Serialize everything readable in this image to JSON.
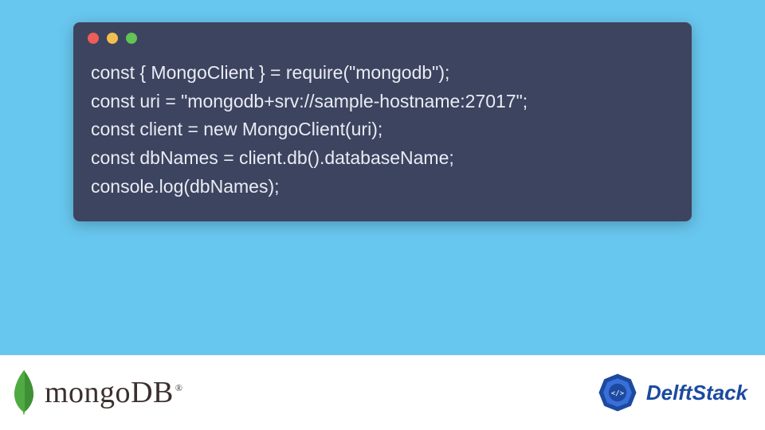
{
  "code": {
    "lines": [
      "const { MongoClient } = require(\"mongodb\");",
      "const uri = \"mongodb+srv://sample-hostname:27017\";",
      "const client = new MongoClient(uri);",
      "const dbNames = client.db().databaseName;",
      "console.log(dbNames);"
    ]
  },
  "window": {
    "dot_red": "close",
    "dot_yellow": "minimize",
    "dot_green": "zoom"
  },
  "footer": {
    "mongo_label": "mongoDB",
    "mongo_trademark": "®",
    "delft_label": "DelftStack"
  },
  "colors": {
    "page_bg": "#68c7ef",
    "card_bg": "#3d445f",
    "code_fg": "#e9ecf4",
    "mongo_leaf": "#4faa41",
    "delft_blue": "#1b4aa0"
  }
}
